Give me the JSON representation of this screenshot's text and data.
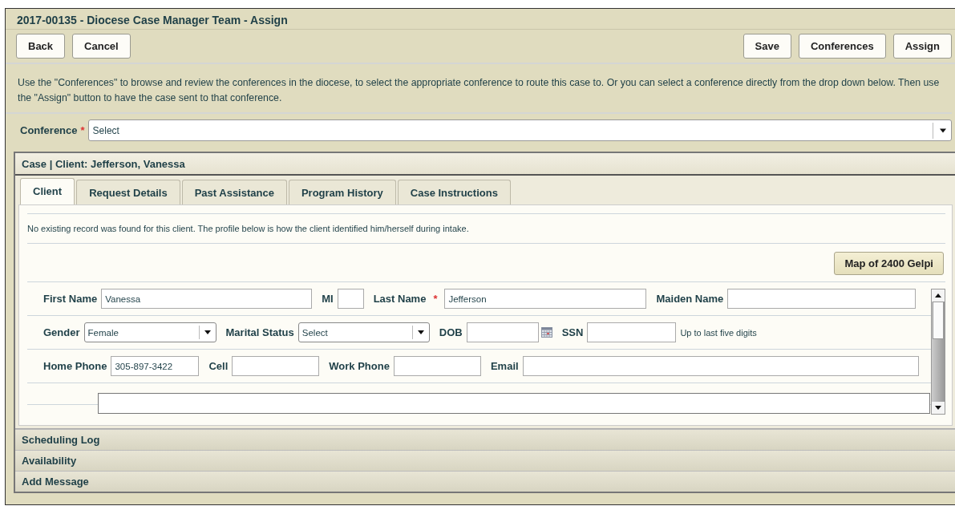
{
  "header": {
    "title": "2017-00135 - Diocese Case Manager Team - Assign"
  },
  "toolbar": {
    "left_buttons": [
      "Back",
      "Cancel"
    ],
    "right_buttons": [
      "Save",
      "Conferences",
      "Assign"
    ]
  },
  "instructions": "Use the \"Conferences\" to browse and review the conferences in the diocese, to select the appropriate conference to route this case to. Or you can select a conference directly from the drop down below. Then use the \"Assign\" button to have the case sent to that conference.",
  "conference": {
    "label": "Conference",
    "required_mark": "*",
    "value": "Select"
  },
  "case_panel": {
    "title": "Case | Client: Jefferson, Vanessa",
    "tabs": [
      {
        "label": "Client",
        "selected": true
      },
      {
        "label": "Request Details",
        "selected": false
      },
      {
        "label": "Past Assistance",
        "selected": false
      },
      {
        "label": "Program History",
        "selected": false
      },
      {
        "label": "Case Instructions",
        "selected": false
      }
    ],
    "notice": "No existing record was found for this client. The profile below is how the client identified him/herself during intake.",
    "map_button": "Map of 2400 Gelpi",
    "form_rows": [
      [
        {
          "kind": "text",
          "label": "First Name",
          "value": "Vanessa"
        },
        {
          "kind": "text",
          "label": "MI"
        },
        {
          "kind": "text",
          "label": "Last Name",
          "required_mark": "*",
          "value": "Jefferson"
        },
        {
          "kind": "text",
          "label": "Maiden Name"
        }
      ],
      [
        {
          "kind": "select",
          "label": "Gender",
          "value": "Female"
        },
        {
          "kind": "select",
          "label": "Marital Status",
          "value": "Select"
        },
        {
          "kind": "date",
          "label": "DOB"
        },
        {
          "kind": "text",
          "label": "SSN",
          "hint": "Up to last five digits"
        }
      ],
      [
        {
          "kind": "text",
          "label": "Home Phone",
          "value": "305-897-3422"
        },
        {
          "kind": "text",
          "label": "Cell"
        },
        {
          "kind": "text",
          "label": "Work Phone"
        },
        {
          "kind": "text",
          "label": "Email"
        }
      ],
      [
        {
          "kind": "text"
        }
      ]
    ]
  },
  "collapsed_sections": [
    "Scheduling Log",
    "Availability",
    "Add Message"
  ]
}
